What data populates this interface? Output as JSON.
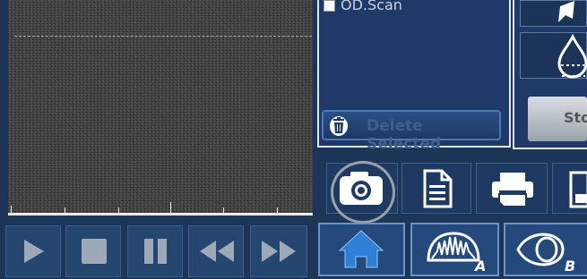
{
  "scan_list": {
    "items": [
      {
        "label": "OD.Scan",
        "checked": false
      }
    ],
    "delete_label": "Delete Selected"
  },
  "right_tools": {
    "stop_label": "Sto"
  },
  "toolbar": {
    "buttons": [
      "camera-icon",
      "document-icon",
      "print-icon",
      "save-icon"
    ]
  },
  "playback": {
    "buttons": [
      "play-icon",
      "stop-icon",
      "pause-icon",
      "rewind-icon",
      "fast-forward-icon"
    ]
  },
  "modes": {
    "home_icon": "home-icon",
    "mode_a_letter": "A",
    "mode_b_letter": "B"
  },
  "colors": {
    "background": "#1d3556",
    "panel_border": "#dfe6ee",
    "icon_gray": "#9ea9b8",
    "home_blue": "#2f7fd6"
  }
}
